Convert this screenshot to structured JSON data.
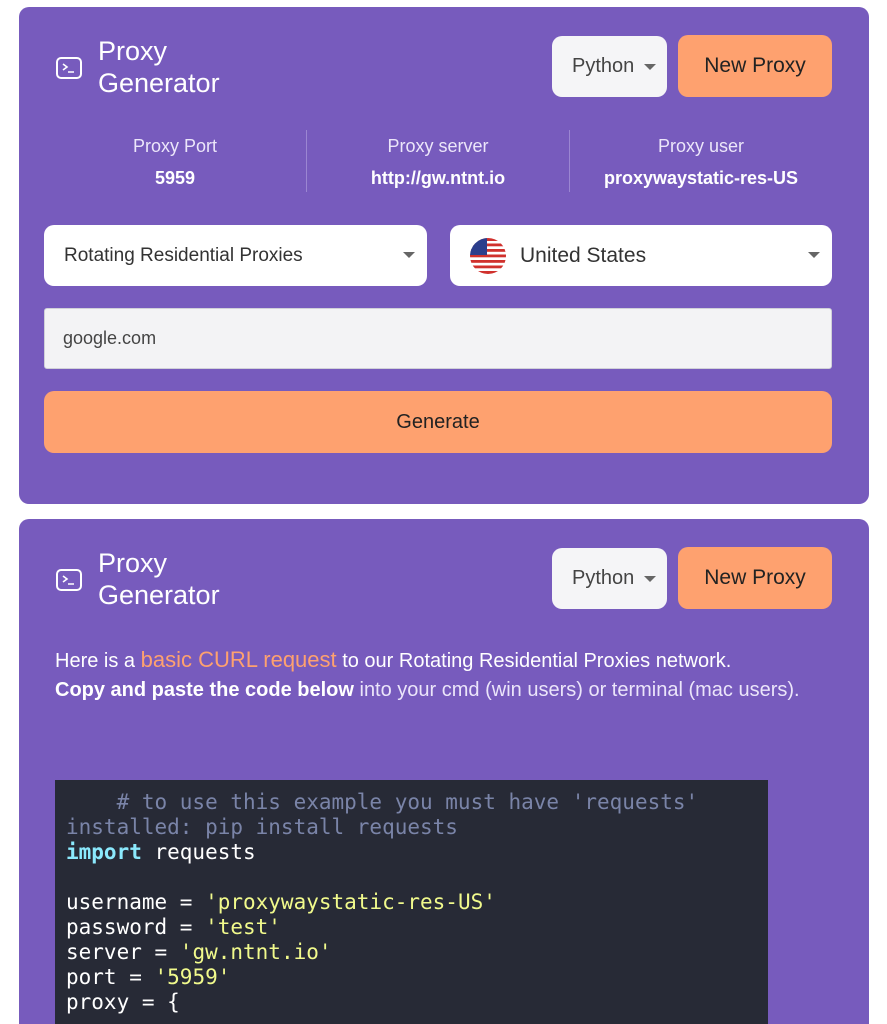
{
  "card1": {
    "title_line1": "Proxy",
    "title_line2": "Generator",
    "language": "Python",
    "new_proxy_label": "New Proxy",
    "stats": [
      {
        "label": "Proxy Port",
        "value": "5959"
      },
      {
        "label": "Proxy server",
        "value": "http://gw.ntnt.io"
      },
      {
        "label": "Proxy user",
        "value": "proxywaystatic-res-US"
      }
    ],
    "proxy_type": "Rotating Residential Proxies",
    "country": "United States",
    "url_value": "google.com",
    "generate_label": "Generate"
  },
  "card2": {
    "title_line1": "Proxy",
    "title_line2": "Generator",
    "language": "Python",
    "new_proxy_label": "New Proxy",
    "desc": {
      "p1_a": "Here is a ",
      "p1_link": "basic CURL request",
      "p1_b": " to our Rotating Residential Proxies network.",
      "p2_bold": "Copy and paste the code below",
      "p2_rest": " into your cmd (win users) or terminal (mac users)."
    },
    "code": {
      "comment_1": "    # to use this example you must have 'requests'",
      "comment_2": "installed: pip install requests",
      "import_kw": "import",
      "import_rest": " requests",
      "username_lhs": "username = ",
      "username_val": "'proxywaystatic-res-US'",
      "password_lhs": "password = ",
      "password_val": "'test'",
      "server_lhs": "server = ",
      "server_val": "'gw.ntnt.io'",
      "port_lhs": "port = ",
      "port_val": "'5959'",
      "proxy_line": "proxy = {"
    }
  },
  "colors": {
    "card_bg": "#775bbd",
    "accent_orange": "#fea16f",
    "code_bg": "#272a36"
  }
}
